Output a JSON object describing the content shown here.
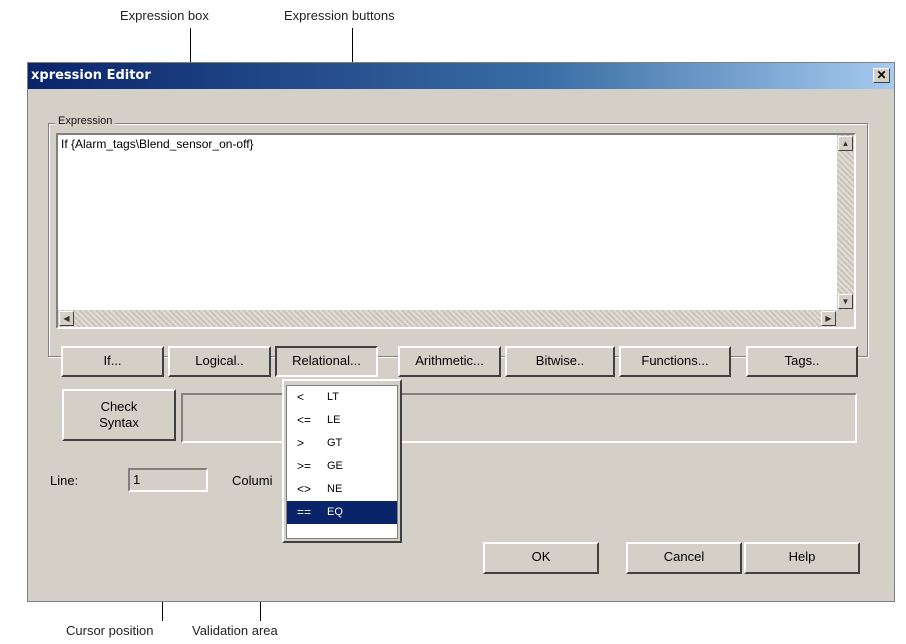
{
  "callouts": {
    "expression_box": "Expression box",
    "expression_buttons": "Expression buttons",
    "cursor_position": "Cursor position",
    "validation_area": "Validation area"
  },
  "window": {
    "title": "xpression Editor",
    "close_glyph": "✕"
  },
  "expression": {
    "group_label": "Expression",
    "text": "If {Alarm_tags\\Blend_sensor_on-off}"
  },
  "buttons": {
    "if": "If...",
    "logical": "Logical..",
    "relational": "Relational...",
    "arithmetic": "Arithmetic...",
    "bitwise": "Bitwise..",
    "functions": "Functions...",
    "tags": "Tags..",
    "check_line1": "Check",
    "check_line2": "Syntax",
    "ok": "OK",
    "cancel": "Cancel",
    "help": "Help"
  },
  "status": {
    "line_label": "Line:",
    "line_value": "1",
    "column_label": "Columi"
  },
  "relational_menu": [
    {
      "op": "<",
      "name": "LT",
      "selected": false
    },
    {
      "op": "<=",
      "name": "LE",
      "selected": false
    },
    {
      "op": ">",
      "name": "GT",
      "selected": false
    },
    {
      "op": ">=",
      "name": "GE",
      "selected": false
    },
    {
      "op": "<>",
      "name": "NE",
      "selected": false
    },
    {
      "op": "==",
      "name": "EQ",
      "selected": true
    }
  ],
  "colors": {
    "titlebar_start": "#0a246a",
    "face": "#d4d0c8",
    "selection": "#0a246a"
  }
}
